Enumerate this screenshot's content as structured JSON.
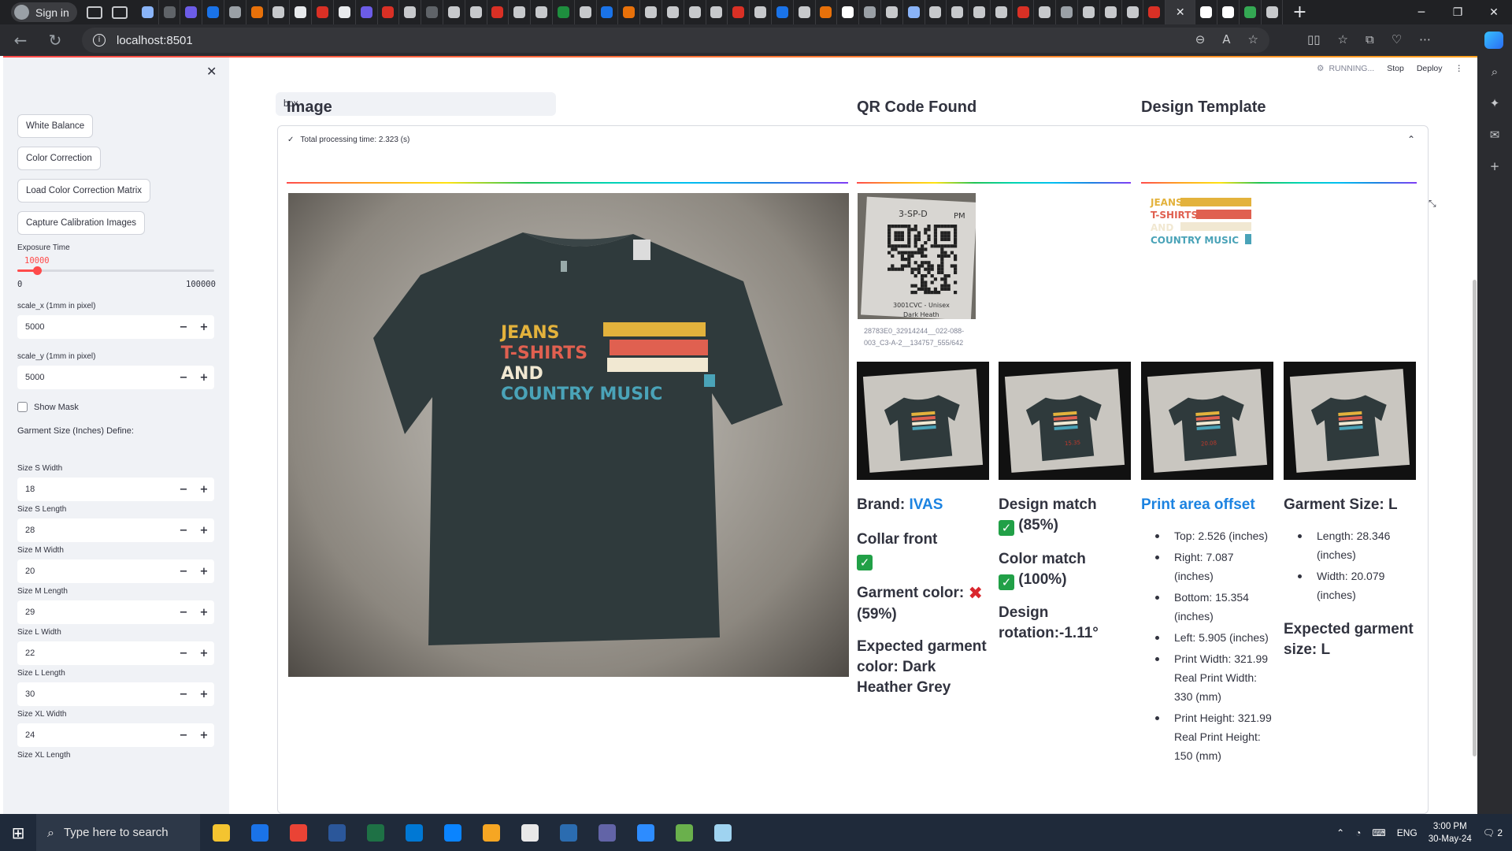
{
  "browser": {
    "signin_label": "Sign in",
    "url": "localhost:8501",
    "tab_colors": [
      "#8ab4f8",
      "#5f6368",
      "#6c5ce7",
      "#1a73e8",
      "#9aa0a6",
      "#e8710a",
      "#c7c9cc",
      "#e8eaed",
      "#d93025",
      "#e8eaed",
      "#6c5ce7",
      "#d93025",
      "#c7c9cc",
      "#5f6368",
      "#c7c9cc",
      "#c7c9cc",
      "#d93025",
      "#c7c9cc",
      "#c7c9cc",
      "#1e8e3e",
      "#c7c9cc",
      "#1a73e8",
      "#e8710a",
      "#c7c9cc",
      "#c7c9cc",
      "#c7c9cc",
      "#c7c9cc",
      "#d93025",
      "#c7c9cc",
      "#1a73e8",
      "#c7c9cc",
      "#e8710a",
      "#ffffff",
      "#9aa0a6",
      "#c7c9cc",
      "#8ab4f8",
      "#c7c9cc",
      "#c7c9cc",
      "#c7c9cc",
      "#c7c9cc",
      "#d93025",
      "#c7c9cc",
      "#9aa0a6",
      "#c7c9cc",
      "#c7c9cc",
      "#c7c9cc",
      "#d93025",
      "#ffffff",
      "#ffffff",
      "#34a853",
      "#c7c9cc"
    ],
    "active_tab_close": "✕",
    "new_tab": "+"
  },
  "sidebar": {
    "buttons": [
      "White Balance",
      "Color Correction",
      "Load Color Correction Matrix",
      "Capture Calibration Images"
    ],
    "exposure": {
      "label": "Exposure Time",
      "value": "10000",
      "min": "0",
      "max": "100000",
      "fraction": 0.1
    },
    "scale_x": {
      "label": "scale_x (1mm in pixel)",
      "value": "5000"
    },
    "scale_y": {
      "label": "scale_y (1mm in pixel)",
      "value": "5000"
    },
    "show_mask": "Show Mask",
    "garment_heading": "Garment Size (Inches) Define:",
    "sizes": [
      {
        "label": "Size S Width",
        "value": "18"
      },
      {
        "label": "Size S Length",
        "value": "28"
      },
      {
        "label": "Size M Width",
        "value": "20"
      },
      {
        "label": "Size M Length",
        "value": "29"
      },
      {
        "label": "Size L Width",
        "value": "22"
      },
      {
        "label": "Size L Length",
        "value": "30"
      },
      {
        "label": "Size XL Width",
        "value": "24"
      },
      {
        "label": "Size XL Length",
        "value": ""
      }
    ]
  },
  "toolbar": {
    "running": "RUNNING...",
    "stop": "Stop",
    "deploy": "Deploy"
  },
  "main": {
    "text_value": "box",
    "expander_title": "Total processing time: 2.323 (s)",
    "col_image": "Image",
    "col_qr": "QR Code Found",
    "col_design": "Design Template",
    "qr_caption": "28783E0_32914244__022-088-003_C3-A-2__134757_555/642",
    "qr_label_top": "3-SP-D",
    "qr_label_pm": "PM",
    "qr_label_bottom": "3001CVC - Unisex",
    "qr_label_bottom2": "Dark Heath",
    "brand_label": "Brand:",
    "brand_value": "IVAS",
    "collar": "Collar front",
    "garment_color": "Garment color:",
    "garment_color_pct": "(59%)",
    "expected_color": "Expected garment color: Dark Heather Grey",
    "design_match": "Design match",
    "design_match_pct": "(85%)",
    "color_match": "Color match",
    "color_match_pct": "(100%)",
    "design_rotation": "Design rotation:-1.11°",
    "print_offset": "Print area offset",
    "offsets": [
      "Top: 2.526 (inches)",
      "Right: 7.087 (inches)",
      "Bottom: 15.354 (inches)",
      "Left: 5.905 (inches)",
      "Print Width: 321.99 Real Print Width: 330 (mm)",
      "Print Height: 321.99 Real Print Height: 150 (mm)"
    ],
    "garment_size": "Garment Size: L",
    "size_items": [
      "Length: 28.346 (inches)",
      "Width: 20.079 (inches)"
    ],
    "expected_size": "Expected garment size: L",
    "check_mark": "✓",
    "cross_mark": "✖",
    "thumb_labels": [
      "",
      "15.35",
      "20.08",
      ""
    ]
  },
  "design_text": [
    "JEANS",
    "T-SHIRTS",
    "AND",
    "COUNTRY MUSIC"
  ],
  "colors": {
    "accent": "#ff4b4b",
    "link": "#1c83e1",
    "check": "#21a047",
    "cross": "#d9262d",
    "yellow": "#e3b23c",
    "red": "#e06050",
    "cream": "#f1e8d2",
    "teal": "#4aa3b8"
  },
  "taskbar": {
    "search_placeholder": "Type here to search",
    "time": "3:00 PM",
    "date": "30-May-24",
    "lang": "ENG",
    "notifications": "2",
    "app_colors": [
      "#f4c430",
      "#1a73e8",
      "#ea4335",
      "#2b579a",
      "#1e7145",
      "#0078d4",
      "#0a84ff",
      "#f6a623",
      "#e8e8e8",
      "#2b6cb0",
      "#6264a7",
      "#2d8cff",
      "#6ab04c",
      "#9fd3f0"
    ]
  }
}
